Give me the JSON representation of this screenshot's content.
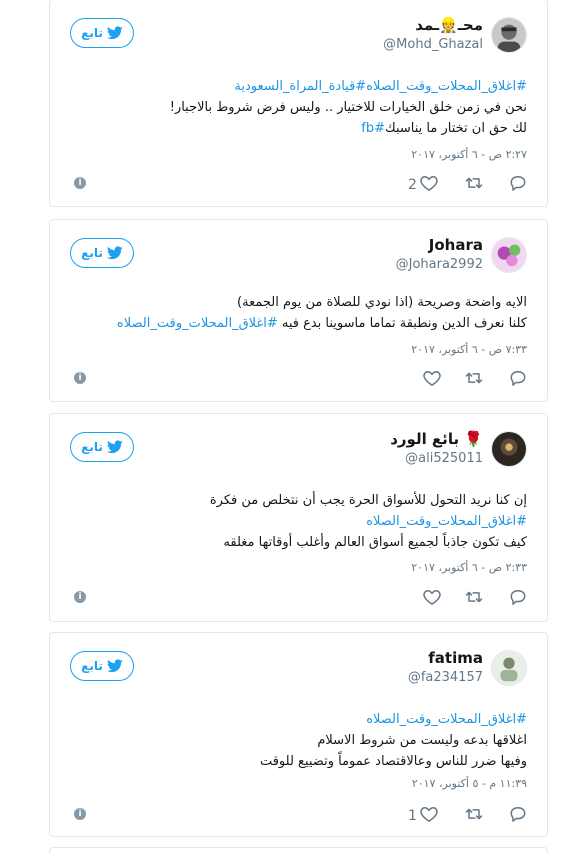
{
  "follow_label": "تابع",
  "tweets": [
    {
      "name": "محـ👷ـمد",
      "handle": "@Mohd_Ghazal",
      "lines": [
        [
          {
            "t": "#اغلاق_المحلات_وقت_الصلاه#قيادة_المراة_السعودية",
            "tag": true
          }
        ],
        [
          {
            "t": "نحن في زمن خلق الخيارات للاختيار .. وليس فرض شروط بالاجبار!",
            "tag": false
          }
        ],
        [
          {
            "t": "لك حق ان تختار ما يناسبك",
            "tag": false
          },
          {
            "t": "#fb",
            "tag": true
          }
        ]
      ],
      "time": "٢:٢٧ ص - ٦ أكتوبر، ٢٠١٧",
      "likes": "2"
    },
    {
      "name": "Johara",
      "handle": "@Johara2992",
      "lines": [
        [
          {
            "t": "الايه واضحة وصريحة (اذا نودي للصلاة من يوم الجمعة)",
            "tag": false
          }
        ],
        [
          {
            "t": "كلنا نعرف الدين ونطبقة تماما ماسوينا بدع فيه ",
            "tag": false
          },
          {
            "t": "#اغلاق_المحلات_وقت_الصلاه",
            "tag": true
          }
        ]
      ],
      "time": "٧:٣٣ ص - ٦ أكتوبر، ٢٠١٧",
      "likes": ""
    },
    {
      "name": "بائع الورد 🌹",
      "handle": "@ali525011",
      "lines": [
        [
          {
            "t": "إن كنا نريد التحول للأسواق الحرة يجب أن نتخلص من فكرة",
            "tag": false
          }
        ],
        [
          {
            "t": "#اغلاق_المحلات_وقت_الصلاه",
            "tag": true
          }
        ],
        [
          {
            "t": "كيف تكون جاذباً لجميع أسواق العالم وأغلب أوقاتها مغلقه",
            "tag": false
          }
        ]
      ],
      "time": "٢:٣٣ ص - ٦ أكتوبر، ٢٠١٧",
      "likes": ""
    },
    {
      "name": "fatima",
      "handle": "@fa234157",
      "lines": [
        [
          {
            "t": "#اغلاق_المحلات_وقت_الصلاه",
            "tag": true
          }
        ],
        [
          {
            "t": "اغلاقها بدعه وليست من شروط الاسلام",
            "tag": false
          }
        ],
        [
          {
            "t": "وفيها ضرر للناس وعالاقتصاد عموماً وتضييع للوقت",
            "tag": false
          }
        ]
      ],
      "time": "١١:٣٩ م - ٥ أكتوبر، ٢٠١٧",
      "likes": "1"
    }
  ]
}
